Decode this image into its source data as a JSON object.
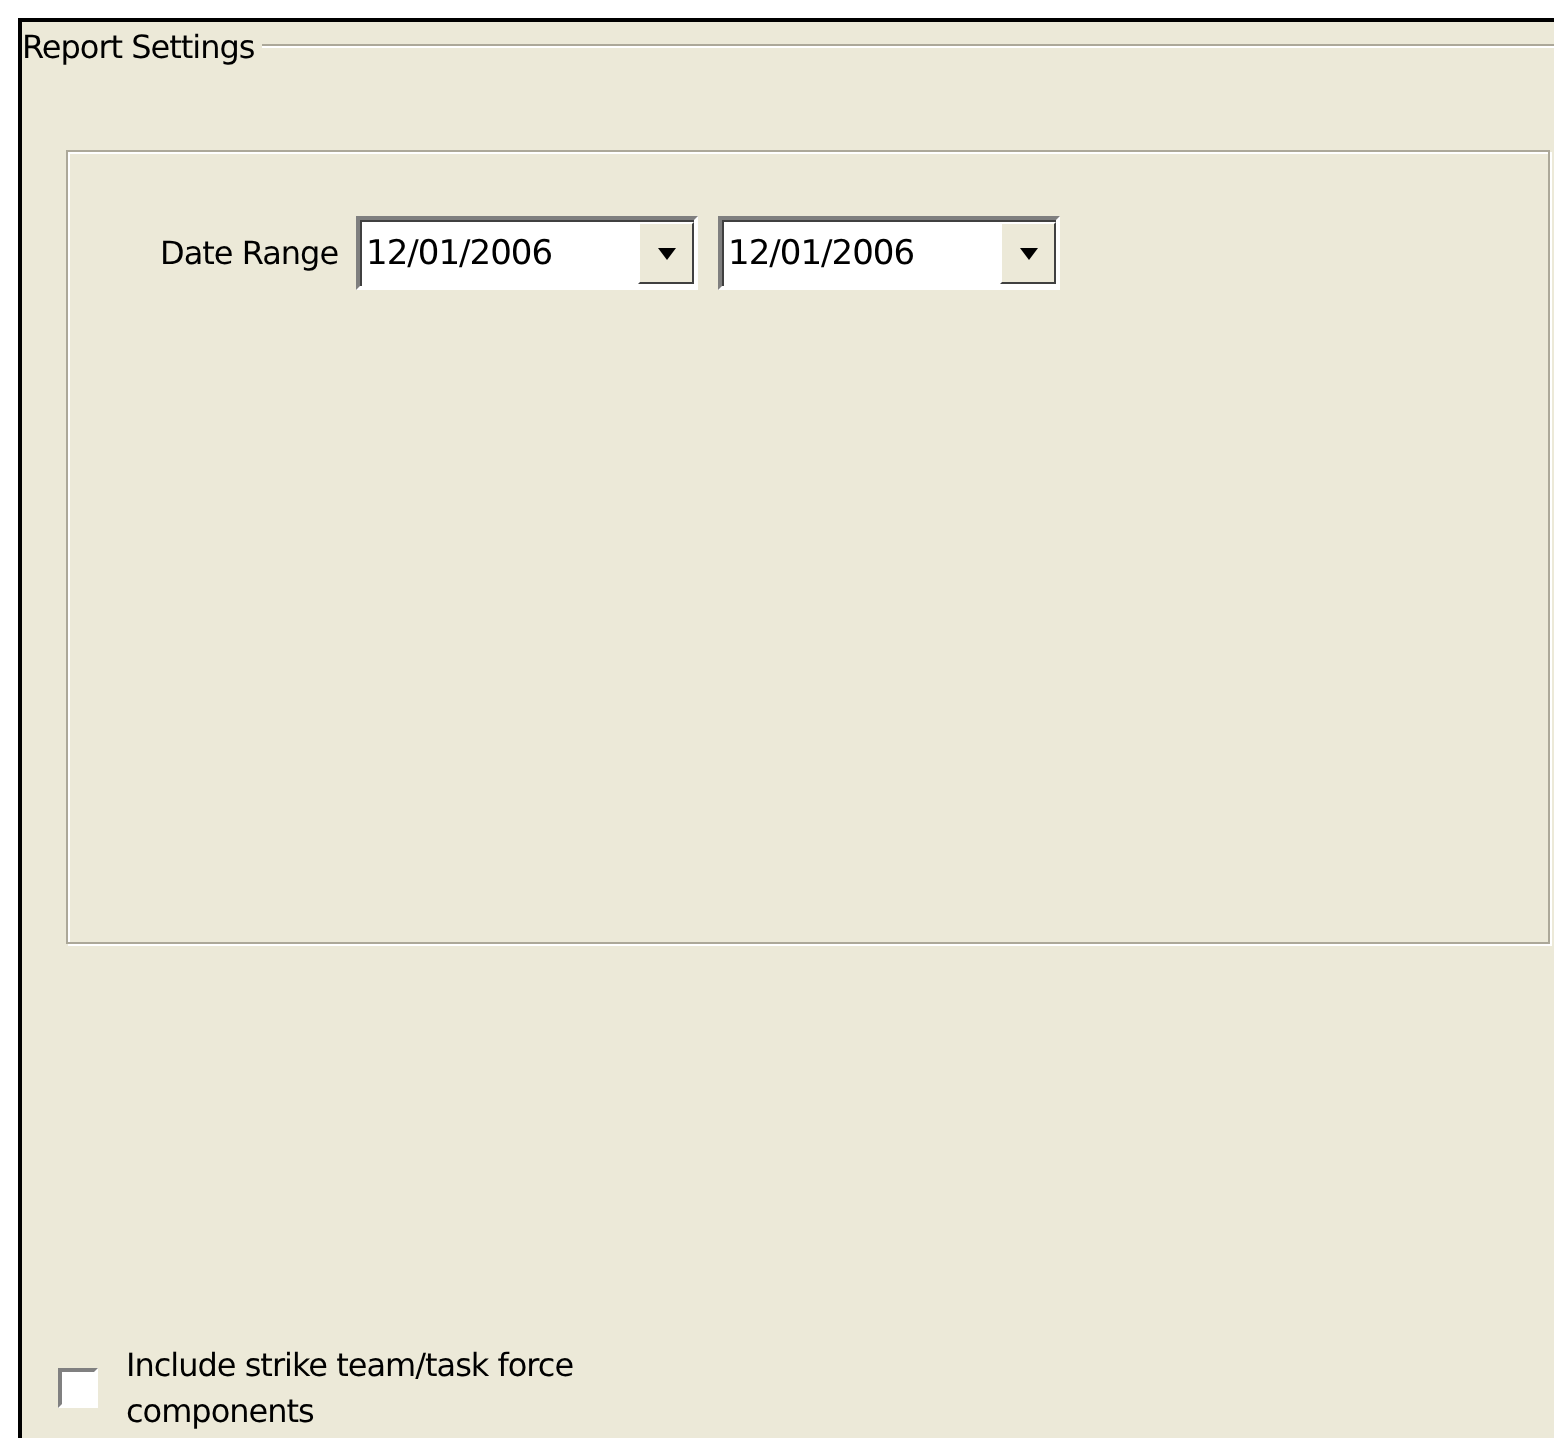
{
  "group": {
    "title": "Report Settings"
  },
  "date_range": {
    "label": "Date Range",
    "from": "12/01/2006",
    "to": "12/01/2006"
  },
  "options": [
    {
      "label": "Include strike team/task force components",
      "checked": false
    }
  ]
}
